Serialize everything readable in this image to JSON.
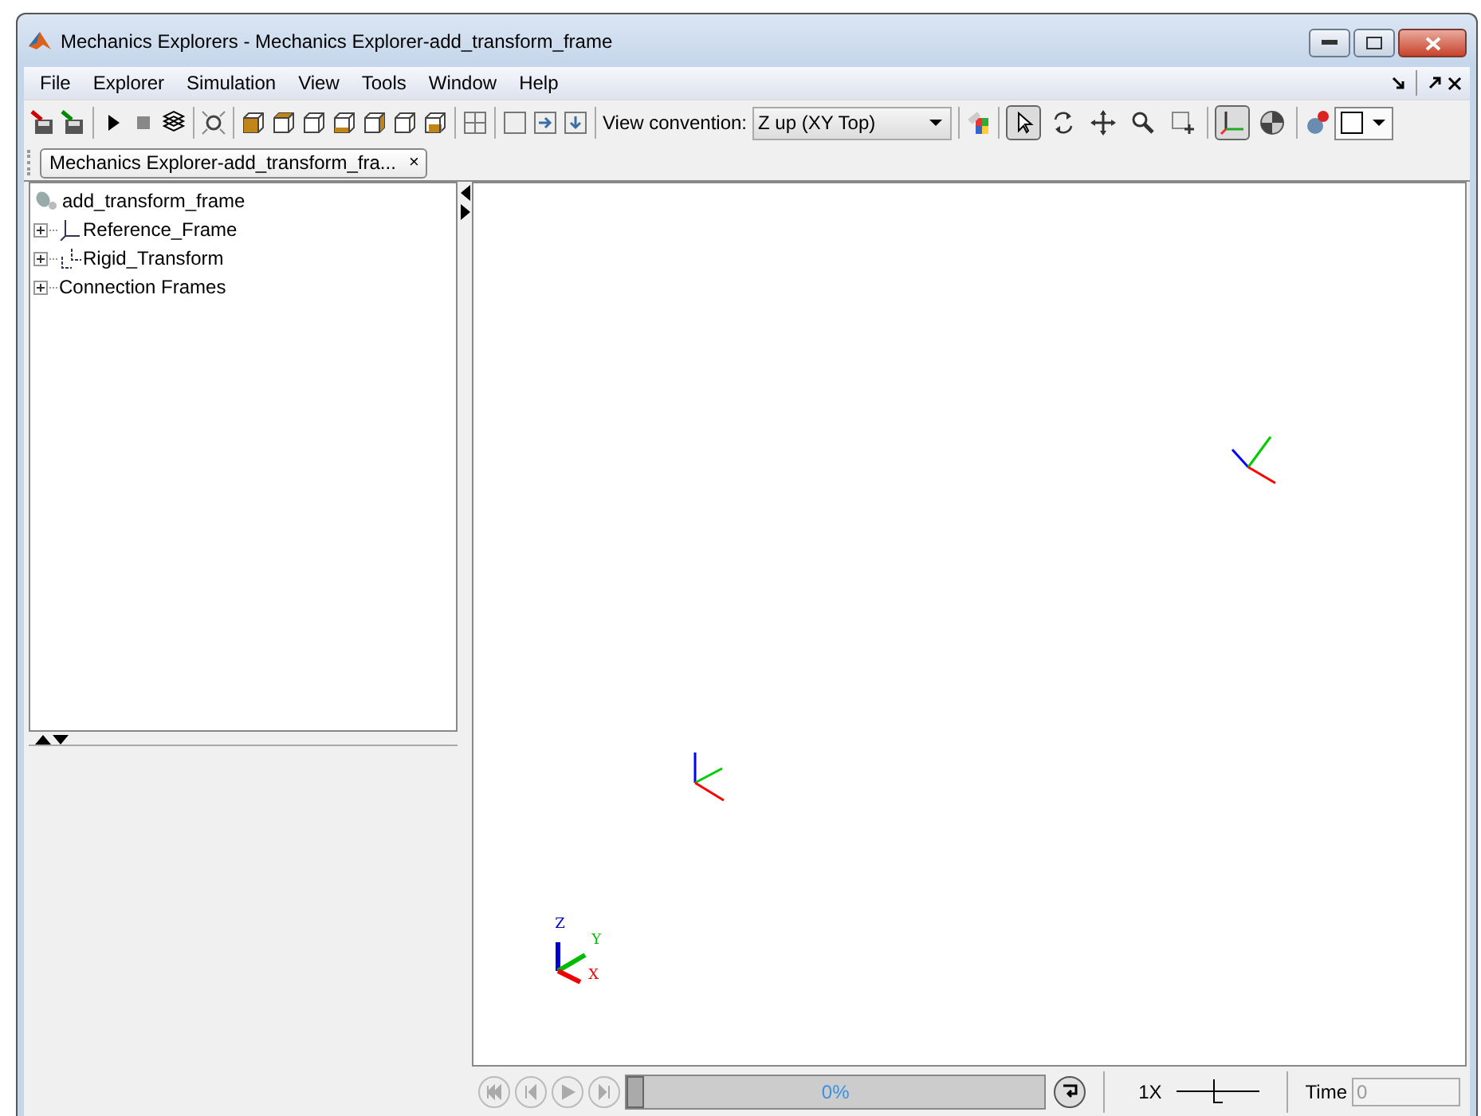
{
  "window": {
    "title": "Mechanics Explorers - Mechanics Explorer-add_transform_frame"
  },
  "menu": [
    "File",
    "Explorer",
    "Simulation",
    "View",
    "Tools",
    "Window",
    "Help"
  ],
  "toolbar": {
    "view_convention_label": "View convention:",
    "view_convention": "Z up (XY Top)",
    "view_tools": [
      {
        "kind": "select",
        "selected": true
      },
      {
        "kind": "rotate",
        "selected": false
      },
      {
        "kind": "pan",
        "selected": false
      },
      {
        "kind": "zoom",
        "selected": false
      },
      {
        "kind": "zoom-box",
        "selected": false
      }
    ],
    "display_toggles": [
      {
        "kind": "axes",
        "selected": true
      },
      {
        "kind": "sphere",
        "selected": false
      }
    ]
  },
  "document_tab": {
    "label": "Mechanics Explorer-add_transform_fra...",
    "close": "×"
  },
  "tree": {
    "root": "add_transform_frame",
    "children": [
      {
        "label": "Reference_Frame",
        "kind": "frame",
        "expanded": false
      },
      {
        "label": "Rigid_Transform",
        "kind": "transform",
        "expanded": false
      },
      {
        "label": "Connection Frames",
        "kind": "group",
        "expanded": false
      }
    ]
  },
  "triad": {
    "z": "Z",
    "y": "Y",
    "x": "X"
  },
  "playback": {
    "progress": "0%",
    "level": 0,
    "speed": "1X",
    "speed_slider": {
      "level": 0.55
    },
    "time_label": "Time",
    "time_value": "0"
  }
}
